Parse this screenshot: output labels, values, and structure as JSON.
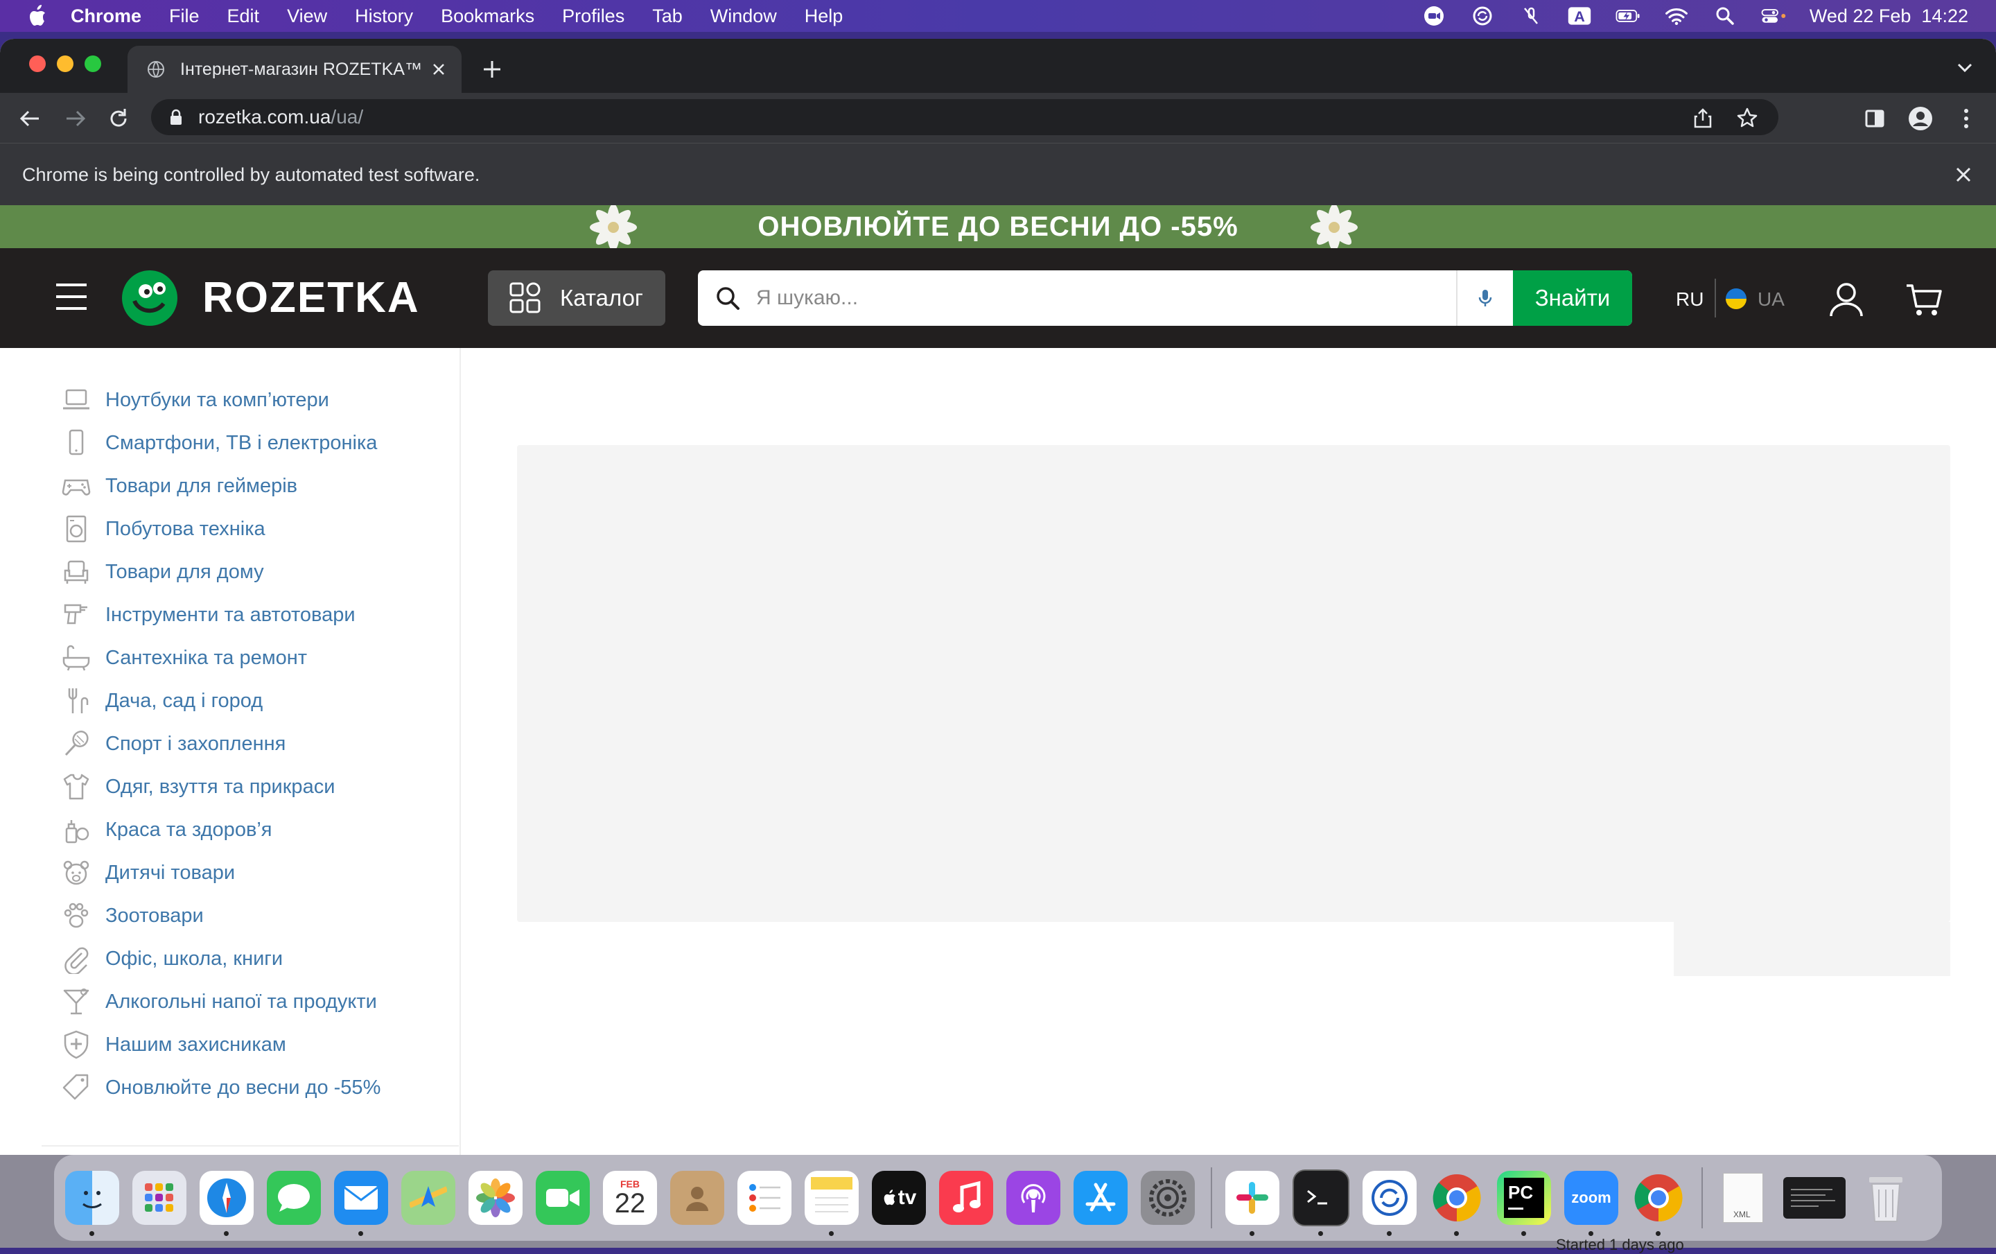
{
  "menubar": {
    "app": "Chrome",
    "items": [
      "File",
      "Edit",
      "View",
      "History",
      "Bookmarks",
      "Profiles",
      "Tab",
      "Window",
      "Help"
    ],
    "clock": "Wed 22 Feb  14:22",
    "tray_icons": [
      "zoom-icon",
      "sync-icon",
      "mute-icon",
      "keyboard-a-icon",
      "battery-icon",
      "wifi-icon",
      "spotlight-icon",
      "control-center-icon"
    ]
  },
  "browser": {
    "tab_title": "Інтернет-магазин ROZETKA™",
    "url_host": "rozetka.com.ua",
    "url_path": "/ua/",
    "infobar": "Chrome is being controlled by automated test software."
  },
  "promo": {
    "text": "ОНОВЛЮЙТЕ ДО ВЕСНИ ДО -55%"
  },
  "header": {
    "logo": "ROZETKA",
    "catalog": "Каталог",
    "search_placeholder": "Я шукаю...",
    "search_button": "Знайти",
    "lang_ru": "RU",
    "lang_ua": "UA"
  },
  "categories": [
    {
      "label": "Ноутбуки та комп’ютери",
      "icon": "laptop-icon"
    },
    {
      "label": "Смартфони, ТВ і електроніка",
      "icon": "smartphone-icon"
    },
    {
      "label": "Товари для геймерів",
      "icon": "gamepad-icon"
    },
    {
      "label": "Побутова техніка",
      "icon": "washing-machine-icon"
    },
    {
      "label": "Товари для дому",
      "icon": "armchair-icon"
    },
    {
      "label": "Інструменти та автотовари",
      "icon": "drill-icon"
    },
    {
      "label": "Сантехніка та ремонт",
      "icon": "bathtub-icon"
    },
    {
      "label": "Дача, сад і город",
      "icon": "garden-fork-icon"
    },
    {
      "label": "Спорт і захоплення",
      "icon": "racket-icon"
    },
    {
      "label": "Одяг, взуття та прикраси",
      "icon": "tshirt-icon"
    },
    {
      "label": "Краса та здоров’я",
      "icon": "cosmetics-icon"
    },
    {
      "label": "Дитячі товари",
      "icon": "teddy-bear-icon"
    },
    {
      "label": "Зоотовари",
      "icon": "paw-icon"
    },
    {
      "label": "Офіс, школа, книги",
      "icon": "paperclip-icon"
    },
    {
      "label": "Алкогольні напої та продукти",
      "icon": "cocktail-icon"
    },
    {
      "label": "Нашим захисникам",
      "icon": "shield-icon"
    },
    {
      "label": "Оновлюйте до весни до -55%",
      "icon": "tag-icon"
    }
  ],
  "dock": {
    "calendar_month": "FEB",
    "calendar_day": "22",
    "tv_label": "tv",
    "pycharm_label": "PC",
    "zoom_label": "zoom",
    "doc_label": "XML",
    "status_text": "Started 1 days ago"
  },
  "colors": {
    "rozetka_green": "#00a046",
    "header_bg": "#221f1f",
    "category_link": "#3e77aa",
    "promo_bg": "#5f8a4a"
  }
}
